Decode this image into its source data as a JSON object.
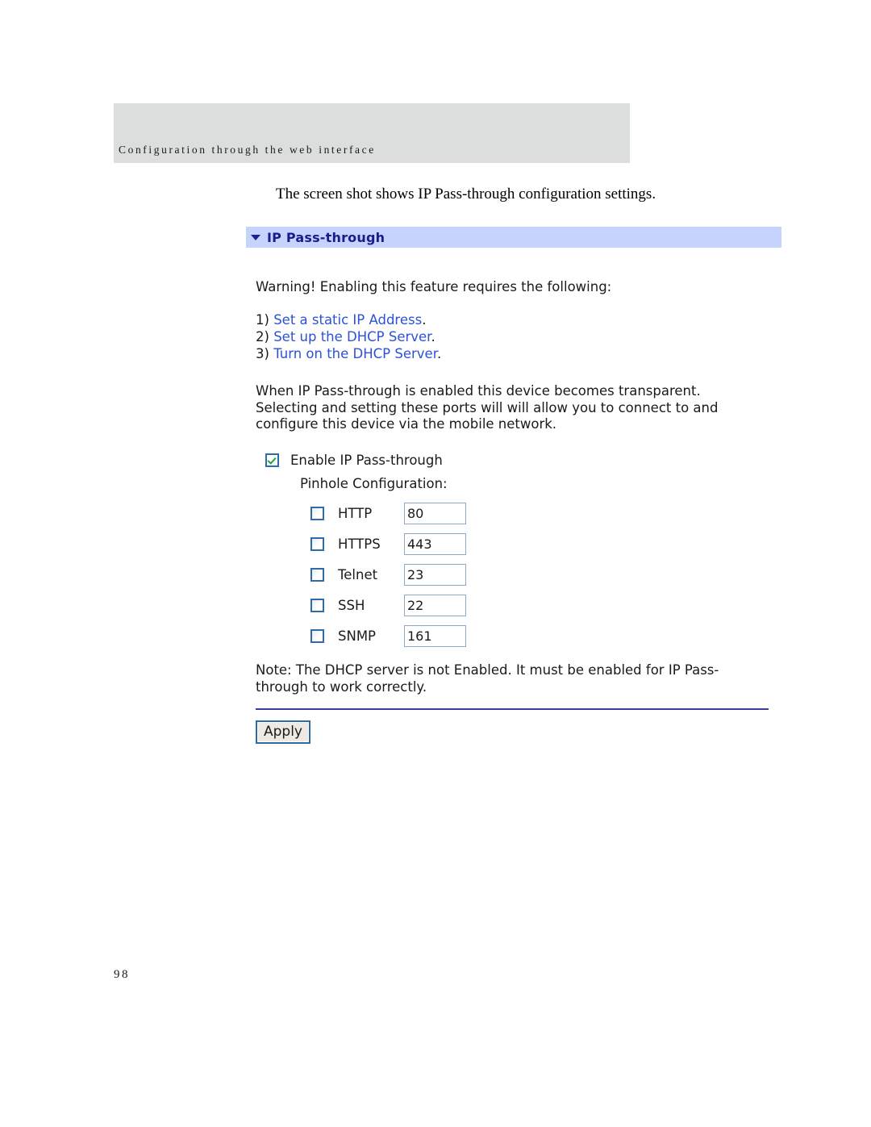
{
  "page": {
    "running_header": "Configuration through the web interface",
    "intro_text": "The screen shot shows IP Pass-through configuration settings.",
    "page_number": "98"
  },
  "webui": {
    "panel": {
      "title": "IP Pass-through",
      "collapse_icon": "triangle-down-icon",
      "title_bar_color": "#c4d4fc",
      "title_text_color": "#1b1b8c"
    },
    "warning_line": "Warning! Enabling this feature requires the following:",
    "requirements": [
      {
        "number": "1)",
        "link_text": "Set a static IP Address",
        "period": "."
      },
      {
        "number": "2)",
        "link_text": "Set up the DHCP Server",
        "period": "."
      },
      {
        "number": "3)",
        "link_text": "Turn on the DHCP Server",
        "period": "."
      }
    ],
    "link_color": "#2b52d8",
    "description": "When IP Pass-through is enabled this device becomes transparent. Selecting and setting these ports will will allow you to connect to and configure this device via the mobile network.",
    "enable": {
      "label": "Enable IP Pass-through",
      "checked": true
    },
    "pinhole_label": "Pinhole Configuration:",
    "ports": [
      {
        "name": "HTTP",
        "value": "80",
        "checked": false
      },
      {
        "name": "HTTPS",
        "value": "443",
        "checked": false
      },
      {
        "name": "Telnet",
        "value": "23",
        "checked": false
      },
      {
        "name": "SSH",
        "value": "22",
        "checked": false
      },
      {
        "name": "SNMP",
        "value": "161",
        "checked": false
      }
    ],
    "note": "Note: The DHCP server is not Enabled. It must be enabled for IP Pass-through to work correctly.",
    "apply_label": "Apply"
  }
}
